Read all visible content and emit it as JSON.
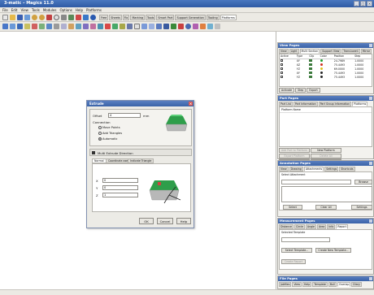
{
  "window": {
    "title": "3-matic – Magics 11.0"
  },
  "menu": [
    "File",
    "Edit",
    "View",
    "Tools",
    "Modules",
    "Options",
    "Help",
    "Platforms"
  ],
  "toolbar_tabs": [
    "Free",
    "Sheets",
    "Fix",
    "Marking",
    "Tools",
    "Smart Part",
    "Support Generation",
    "Tooling",
    "Platforms"
  ],
  "view_pages": {
    "title": "View Pages",
    "tabs": [
      "View",
      "Light",
      "Multi Section",
      "Support View",
      "Translucent",
      "Mirror"
    ],
    "table": {
      "headers": [
        "Active",
        "Type",
        "Clip",
        "Color",
        "Position",
        "Step"
      ],
      "rows": [
        {
          "type": "XY",
          "color": "#1e9e2e",
          "position": "24.7989",
          "step": "1.0000"
        },
        {
          "type": "XZ",
          "color": "#d03020",
          "position": "75.4493",
          "step": "1.0000"
        },
        {
          "type": "YZ",
          "color": "#e0c020",
          "position": "69.0000",
          "step": "1.0000"
        },
        {
          "type": "XY",
          "color": "#222222",
          "position": "75.4493",
          "step": "1.0000"
        },
        {
          "type": "YZ",
          "color": "#222222",
          "position": "75.4493",
          "step": "1.0000"
        }
      ]
    },
    "buttons": [
      "Activate",
      "Step",
      "Export"
    ]
  },
  "part_pages": {
    "title": "Part Pages",
    "tabs": [
      "Part List",
      "Part Information",
      "Part Group Information",
      "Platforms"
    ],
    "list_header": "Platform Name",
    "buttons": [
      "Add Part to Platform",
      "New Platform",
      "Export Platform",
      "Delete All",
      "Go to Container",
      "Detach Parts"
    ]
  },
  "annotation_pages": {
    "title": "Annotation Pages",
    "tabs": [
      "View",
      "Drawing",
      "Attachments",
      "Settings",
      "Shortcuts"
    ],
    "section_label": "Select Attachment",
    "browse": "Browse",
    "buttons": [
      "Select",
      "Clear All",
      "Settings"
    ]
  },
  "measurement_pages": {
    "title": "Measurement Pages",
    "tabs": [
      "Distance",
      "Circle",
      "Angle",
      "Area",
      "Info",
      "Report"
    ],
    "label": "Selected Template",
    "buttons": [
      "Select Template...",
      "Create New Template...",
      "Create Report"
    ]
  },
  "file_pages": {
    "title": "File Pages",
    "tabs": [
      "Jobfiles",
      "View",
      "Help",
      "Template",
      "Bull",
      "Overlap",
      "Diary"
    ]
  },
  "dialog": {
    "title": "Extrude",
    "offset_label": "Offset",
    "offset_value": "4",
    "offset_unit": "mm",
    "connection_label": "Connection",
    "options": [
      "Move Points",
      "Add Triangles",
      "Automatic"
    ],
    "section_title": "Multi Extrude Direction",
    "tabs": [
      "Normal",
      "Coordinate axes",
      "Indicate Triangle"
    ],
    "axes": [
      {
        "label": "X",
        "value": "0"
      },
      {
        "label": "Y",
        "value": "0"
      },
      {
        "label": "Z",
        "value": "1"
      }
    ],
    "buttons": [
      "OK",
      "Cancel",
      "Help"
    ]
  }
}
